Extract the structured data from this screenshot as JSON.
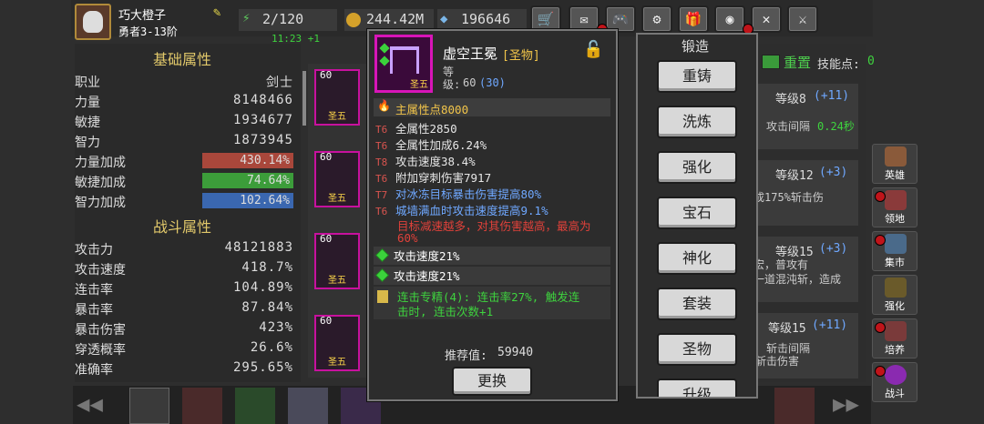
{
  "player": {
    "name": "巧大橙子",
    "rank": "勇者3-13阶",
    "energy": "2/120",
    "timer": "11:23 +1",
    "gold": "244.42M",
    "gems": "196646"
  },
  "base_stats": {
    "title": "基础属性",
    "rows": [
      {
        "k": "职业",
        "v": "剑士"
      },
      {
        "k": "力量",
        "v": "8148466"
      },
      {
        "k": "敏捷",
        "v": "1934677"
      },
      {
        "k": "智力",
        "v": "1873945"
      }
    ],
    "bars": [
      {
        "k": "力量加成",
        "v": "430.14%",
        "color": "#a9473b"
      },
      {
        "k": "敏捷加成",
        "v": "74.64%",
        "color": "#3c9d3a"
      },
      {
        "k": "智力加成",
        "v": "102.64%",
        "color": "#3a67b0"
      }
    ]
  },
  "combat_stats": {
    "title": "战斗属性",
    "rows": [
      {
        "k": "攻击力",
        "v": "48121883"
      },
      {
        "k": "攻击速度",
        "v": "418.7%"
      },
      {
        "k": "连击率",
        "v": "104.89%"
      },
      {
        "k": "暴击率",
        "v": "87.84%"
      },
      {
        "k": "暴击伤害",
        "v": "423%"
      },
      {
        "k": "穿透概率",
        "v": "26.6%"
      },
      {
        "k": "准确率",
        "v": "295.65%"
      }
    ]
  },
  "inventory_cards": [
    {
      "level": "60",
      "grade": "圣五"
    },
    {
      "level": "60",
      "grade": "圣五"
    },
    {
      "level": "60",
      "grade": "圣五"
    },
    {
      "level": "60",
      "grade": "圣五"
    }
  ],
  "skills": {
    "reset": "重置",
    "points_label": "技能点:",
    "points": "0",
    "cards": [
      {
        "level": "等级8",
        "plus": "(+11)",
        "desc": "攻击间隔",
        "desc_val": "0.24秒"
      },
      {
        "level": "等级12",
        "plus": "(+3)",
        "desc": "成175%斩击伤",
        "desc_val": ""
      },
      {
        "level": "等级15",
        "plus": "(+3)",
        "desc": "宏，普攻有",
        "desc2": "一道混沌斩，造成",
        "desc_val": ""
      },
      {
        "level": "等级15",
        "plus": "(+11)",
        "desc": "斩击间隔",
        "desc2": "斩击伤害",
        "desc_val": ""
      }
    ]
  },
  "item": {
    "name": "虚空王冕",
    "tag": "[圣物]",
    "type": "等",
    "level_label": "级:",
    "level": "60",
    "level_plus": "(30)",
    "badge": "圣五",
    "main_stat": "主属性点8000",
    "attrs": [
      {
        "tier": "T6",
        "text": "全属性2850",
        "color": "#e6e6e6"
      },
      {
        "tier": "T6",
        "text": "全属性加成6.24%",
        "color": "#e6e6e6"
      },
      {
        "tier": "T8",
        "text": "攻击速度38.4%",
        "color": "#e6e6e6"
      },
      {
        "tier": "T6",
        "text": "附加穿刺伤害7917",
        "color": "#e6e6e6"
      },
      {
        "tier": "T7",
        "text": "对冰冻目标暴击伤害提高80%",
        "color": "#6fa8ff"
      },
      {
        "tier": "T6",
        "text": "城墙满血时攻击速度提高9.1%",
        "color": "#6fa8ff"
      }
    ],
    "special": "目标减速越多，对其伤害越高，最高为",
    "special2": "60%",
    "gems": [
      "攻击速度21%",
      "攻击速度21%"
    ],
    "set_text": "连击专精(4): 连击率27%, 触发连",
    "set_text2": "击时, 连击次数+1",
    "recommend_label": "推荐值:",
    "recommend": "59940",
    "replace": "更换"
  },
  "forge": {
    "title": "锻造",
    "buttons": [
      "重铸",
      "洗炼",
      "强化",
      "宝石",
      "神化",
      "套装",
      "圣物",
      "升级"
    ]
  },
  "right_tabs": [
    "英雄",
    "领地",
    "集市",
    "强化",
    "培养",
    "战斗"
  ]
}
